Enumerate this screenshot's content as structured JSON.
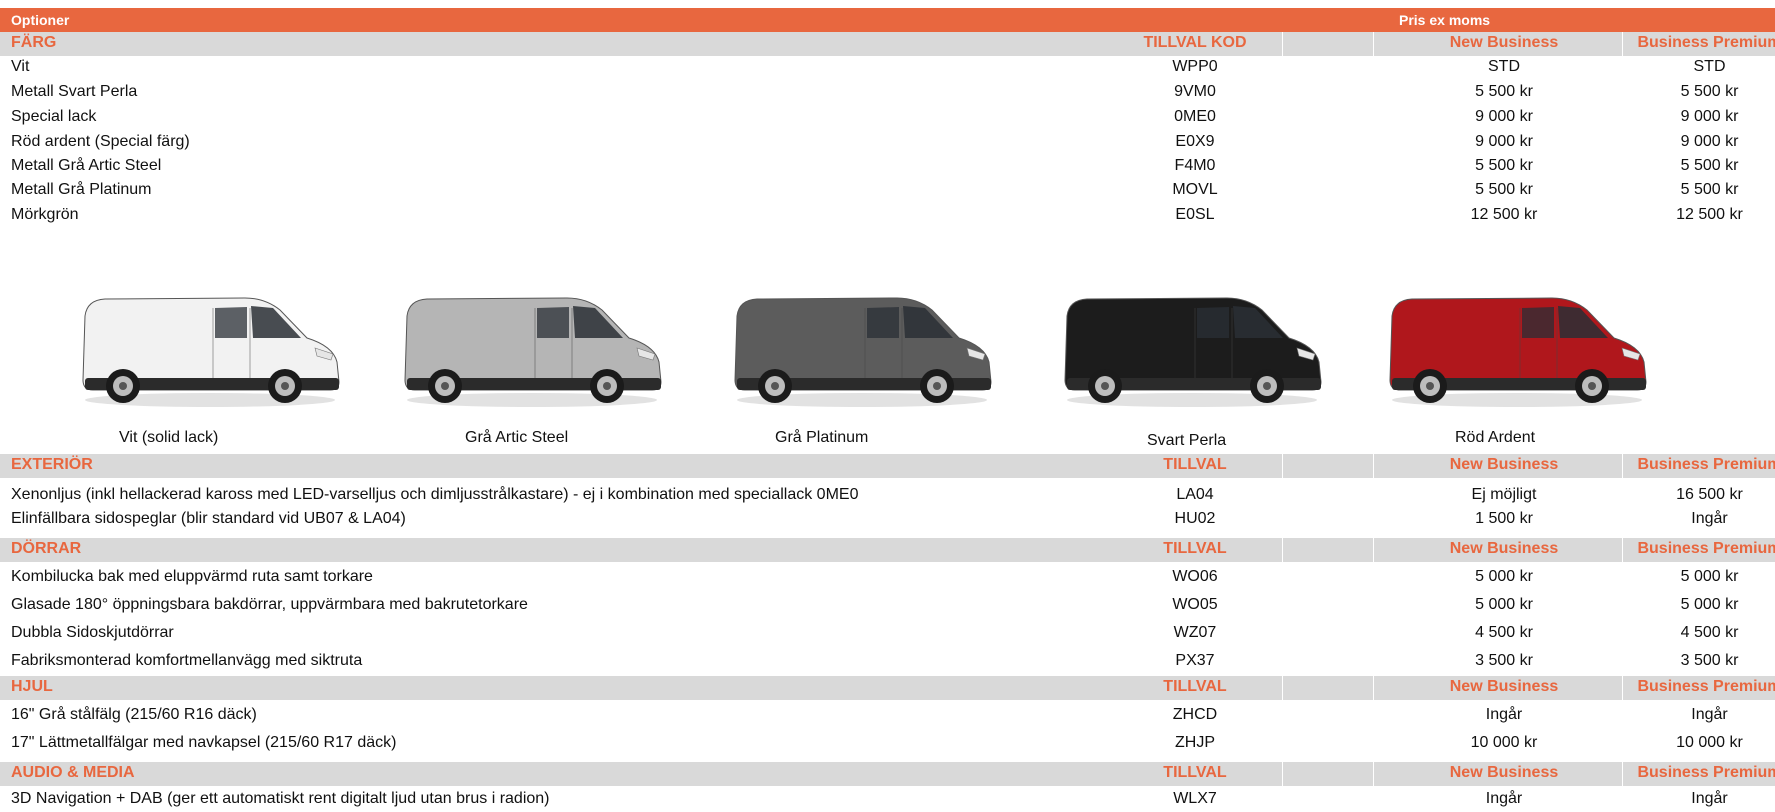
{
  "header": {
    "left": "Optioner",
    "right": "Pris ex moms"
  },
  "colors": {
    "accent": "#e8673f",
    "section_bg": "#d9d9d9"
  },
  "farg": {
    "title": "FÄRG",
    "col_code": "TILLVAL KOD",
    "col_nb": "New Business",
    "col_bp": "Business Premium",
    "rows": [
      {
        "name": "Vit",
        "code": "WPP0",
        "nb": "STD",
        "bp": "STD"
      },
      {
        "name": "Metall Svart Perla",
        "code": "9VM0",
        "nb": "5 500 kr",
        "bp": "5 500 kr"
      },
      {
        "name": "Special lack",
        "code": "0ME0",
        "nb": "9 000 kr",
        "bp": "9 000 kr"
      },
      {
        "name": "Röd ardent (Special färg)",
        "code": "E0X9",
        "nb": "9 000 kr",
        "bp": "9 000 kr"
      },
      {
        "name": "Metall Grå Artic Steel",
        "code": "F4M0",
        "nb": "5 500 kr",
        "bp": "5 500 kr"
      },
      {
        "name": "Metall Grå Platinum",
        "code": "MOVL",
        "nb": "5 500 kr",
        "bp": "5 500 kr"
      },
      {
        "name": "Mörkgrön",
        "code": "E0SL",
        "nb": "12 500 kr",
        "bp": "12 500 kr"
      }
    ]
  },
  "vans": [
    {
      "label": "Vit (solid lack)",
      "color": "#f2f2f2"
    },
    {
      "label": "Grå Artic Steel",
      "color": "#b5b5b5"
    },
    {
      "label": "Grå Platinum",
      "color": "#5c5c5c"
    },
    {
      "label": "Svart Perla",
      "color": "#1c1c1c"
    },
    {
      "label": "Röd Ardent",
      "color": "#b0171c"
    }
  ],
  "exterior": {
    "title": "EXTERIÖR",
    "col_code": "TILLVAL",
    "col_nb": "New Business",
    "col_bp": "Business Premium",
    "rows": [
      {
        "name": "Xenonljus (inkl hellackerad kaross med LED-varselljus och dimljusstrålkastare) - ej i kombination med speciallack 0ME0",
        "code": "LA04",
        "nb": "Ej möjligt",
        "bp": "16 500 kr"
      },
      {
        "name": "Elinfällbara sidospeglar (blir standard vid UB07 & LA04)",
        "code": "HU02",
        "nb": "1 500 kr",
        "bp": "Ingår"
      }
    ]
  },
  "dorrar": {
    "title": "DÖRRAR",
    "col_code": "TILLVAL",
    "col_nb": "New Business",
    "col_bp": "Business Premium",
    "rows": [
      {
        "name": "Kombilucka bak med eluppvärmd ruta samt torkare",
        "code": "WO06",
        "nb": "5 000 kr",
        "bp": "5 000 kr"
      },
      {
        "name": "Glasade 180° öppningsbara bakdörrar, uppvärmbara med bakrutetorkare",
        "code": "WO05",
        "nb": "5 000 kr",
        "bp": "5 000 kr"
      },
      {
        "name": "Dubbla Sidoskjutdörrar",
        "code": "WZ07",
        "nb": "4 500 kr",
        "bp": "4 500 kr"
      },
      {
        "name": "Fabriksmonterad komfortmellanvägg med siktruta",
        "code": "PX37",
        "nb": "3 500 kr",
        "bp": "3 500 kr"
      }
    ]
  },
  "hjul": {
    "title": "HJUL",
    "col_code": "TILLVAL",
    "col_nb": "New Business",
    "col_bp": "Business Premium",
    "rows": [
      {
        "name": "16\" Grå stålfälg (215/60 R16 däck)",
        "code": "ZHCD",
        "nb": "Ingår",
        "bp": "Ingår"
      },
      {
        "name": "17\" Lättmetallfälgar med navkapsel (215/60 R17 däck)",
        "code": "ZHJP",
        "nb": "10 000 kr",
        "bp": "10 000 kr"
      }
    ]
  },
  "audio": {
    "title": "AUDIO & MEDIA",
    "col_code": "TILLVAL",
    "col_nb": "New Business",
    "col_bp": "Business Premium",
    "rows": [
      {
        "name": "3D Navigation + DAB (ger ett automatiskt rent digitalt ljud utan brus i radion)",
        "code": "WLX7",
        "nb": "Ingår",
        "bp": "Ingår"
      }
    ]
  }
}
